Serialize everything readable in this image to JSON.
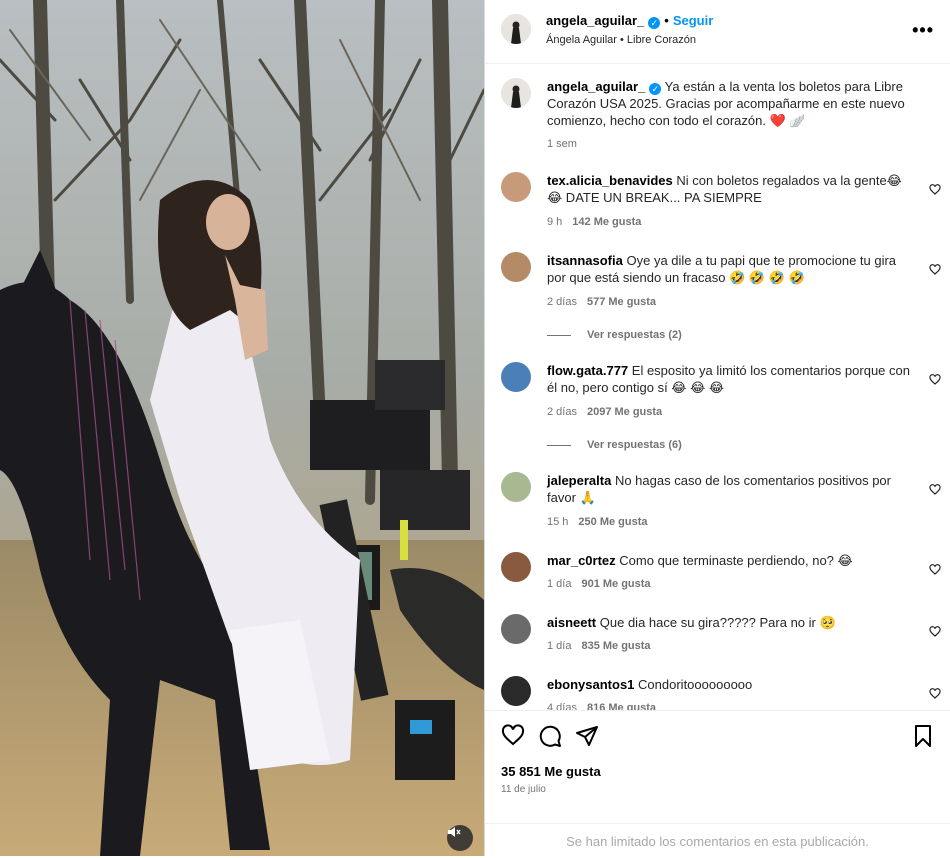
{
  "header": {
    "username": "angela_aguilar_",
    "follow_label": "Seguir",
    "subtitle": "Ángela Aguilar • Libre Corazón",
    "more_glyph": "•••"
  },
  "caption": {
    "username": "angela_aguilar_",
    "text": "Ya están a la venta los boletos para Libre Corazón USA 2025. Gracias por acompañarme en este nuevo comienzo, hecho con todo el corazón. ❤️ 🪽",
    "time": "1 sem"
  },
  "comments": [
    {
      "username": "tex.alicia_benavides",
      "text": "Ni con boletos regalados va la gente😂 😂 DATE UN BREAK... PA SIEMPRE",
      "time": "9 h",
      "likes": "142 Me gusta",
      "avatar_color": "#c79a7a"
    },
    {
      "username": "itsannasofia",
      "text": "Oye ya dile a tu papi que te promocione tu gira por que está siendo un fracaso 🤣 🤣 🤣 🤣",
      "time": "2 días",
      "likes": "577 Me gusta",
      "replies": "Ver respuestas (2)",
      "avatar_color": "#b58a66"
    },
    {
      "username": "flow.gata.777",
      "text": "El esposito ya limitó los comentarios porque con él no, pero contigo sí 😂 😂 😂",
      "time": "2 días",
      "likes": "2097 Me gusta",
      "replies": "Ver respuestas (6)",
      "avatar_color": "#4a7fb8"
    },
    {
      "username": "jaleperalta",
      "text": "No hagas caso de los comentarios positivos por favor 🙏",
      "time": "15 h",
      "likes": "250 Me gusta",
      "avatar_color": "#a8b890"
    },
    {
      "username": "mar_c0rtez",
      "text": "Como que terminaste perdiendo, no? 😂",
      "time": "1 día",
      "likes": "901 Me gusta",
      "avatar_color": "#8a5a40"
    },
    {
      "username": "aisneett",
      "text": "Que dia hace su gira????? Para no ir 🥺",
      "time": "1 día",
      "likes": "835 Me gusta",
      "avatar_color": "#6a6a6a"
    },
    {
      "username": "ebonysantos1",
      "text": "Condoritooooooooo",
      "time": "4 días",
      "likes": "816 Me gusta",
      "avatar_color": "#2a2a2a"
    }
  ],
  "actions": {
    "likes": "35 851 Me gusta",
    "date": "11 de julio",
    "limited_notice": "Se han limitado los comentarios en esta publicación."
  },
  "colors": {
    "accent": "#0095f6",
    "secondary_text": "#737373",
    "heart_red": "#e0245e"
  }
}
